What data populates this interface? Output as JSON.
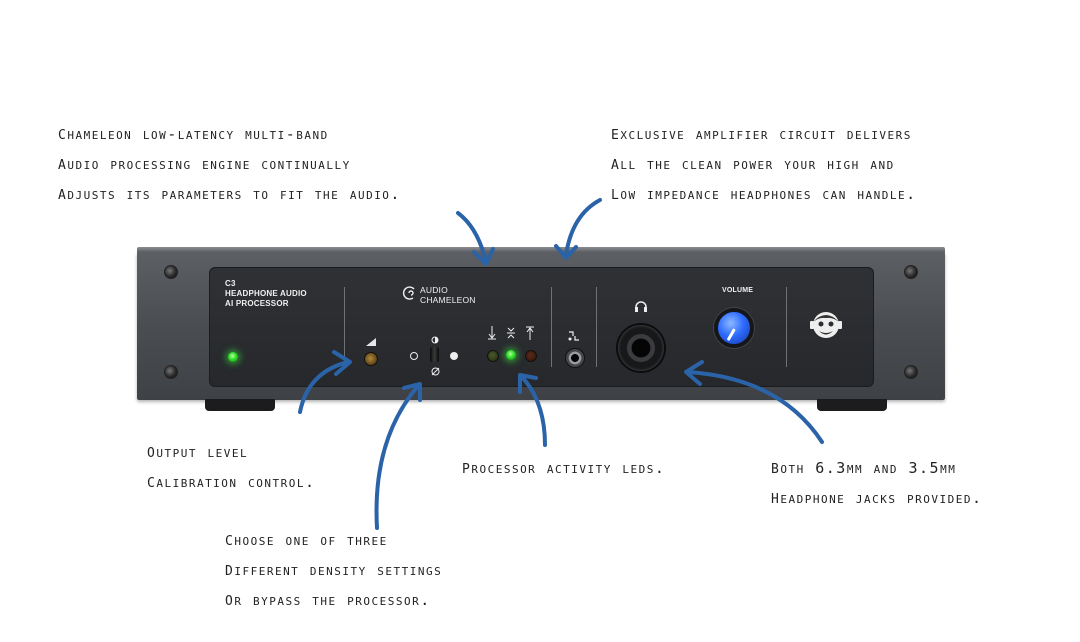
{
  "annotations": {
    "engine": {
      "lines": [
        "Chameleon low-latency multi-band",
        "audio Processing engine continually",
        "adjusts its parameters to fit the audio."
      ]
    },
    "amplifier": {
      "lines": [
        "Exclusive amplifier circuit delivers",
        "all the clean power your high and",
        "low impedance headphones can handle."
      ]
    },
    "output_level": {
      "lines": [
        "Output level",
        "calibration control."
      ]
    },
    "processor_leds": {
      "lines": [
        "Processor activity LEDs."
      ]
    },
    "jacks": {
      "lines": [
        "Both 6.3mm and 3.5mm",
        "headphone jacks provided."
      ]
    },
    "density": {
      "lines": [
        "Choose one of three",
        "different density settings",
        "or bypass the processor."
      ]
    }
  },
  "device": {
    "model_lines": [
      "C3",
      "HEADPHONE AUDIO",
      "AI PROCESSOR"
    ],
    "brand_lines": [
      "AUDIO",
      "CHAMELEON"
    ],
    "volume_label": "VOLUME",
    "power_led_state": "on",
    "activity_leds": [
      {
        "icon": "arrow-down",
        "state": "dim",
        "color": "#2ddc2a"
      },
      {
        "icon": "compress",
        "state": "on",
        "color": "#2ddc2a"
      },
      {
        "icon": "arrow-up",
        "state": "dim",
        "color": "#c0392b"
      }
    ],
    "accent_color": "#2e6cff",
    "annotation_arrow_color": "#2b63a8"
  }
}
